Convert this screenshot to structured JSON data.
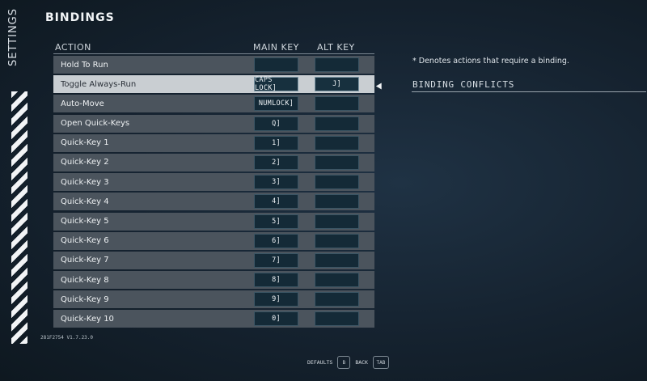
{
  "sidebar": {
    "title": "SETTINGS"
  },
  "page": {
    "title": "BINDINGS"
  },
  "table": {
    "headers": {
      "action": "ACTION",
      "main": "MAIN KEY",
      "alt": "ALT KEY"
    },
    "rows": [
      {
        "action": "Hold To Run",
        "main": "",
        "alt": ""
      },
      {
        "action": "Toggle Always-Run",
        "main": "CAPS LOCK]",
        "alt": "J]"
      },
      {
        "action": "Auto-Move",
        "main": "NUMLOCK]",
        "alt": ""
      },
      {
        "action": "Open Quick-Keys",
        "main": "Q]",
        "alt": ""
      },
      {
        "action": "Quick-Key 1",
        "main": "1]",
        "alt": ""
      },
      {
        "action": "Quick-Key 2",
        "main": "2]",
        "alt": ""
      },
      {
        "action": "Quick-Key 3",
        "main": "3]",
        "alt": ""
      },
      {
        "action": "Quick-Key 4",
        "main": "4]",
        "alt": ""
      },
      {
        "action": "Quick-Key 5",
        "main": "5]",
        "alt": ""
      },
      {
        "action": "Quick-Key 6",
        "main": "6]",
        "alt": ""
      },
      {
        "action": "Quick-Key 7",
        "main": "7]",
        "alt": ""
      },
      {
        "action": "Quick-Key 8",
        "main": "8]",
        "alt": ""
      },
      {
        "action": "Quick-Key 9",
        "main": "9]",
        "alt": ""
      },
      {
        "action": "Quick-Key 10",
        "main": "0]",
        "alt": ""
      }
    ]
  },
  "info": {
    "note": "* Denotes actions that require a binding.",
    "conflicts_title": "BINDING CONFLICTS"
  },
  "version": "281F2754 V1.7.23.0",
  "footer": {
    "defaults_label": "DEFAULTS",
    "defaults_key": "B",
    "back_label": "BACK",
    "back_key": "TAB"
  },
  "colors": {
    "row_bg": "#4b545d",
    "row_selected_bg": "#c9ced2",
    "key_bg": "#142a37"
  }
}
